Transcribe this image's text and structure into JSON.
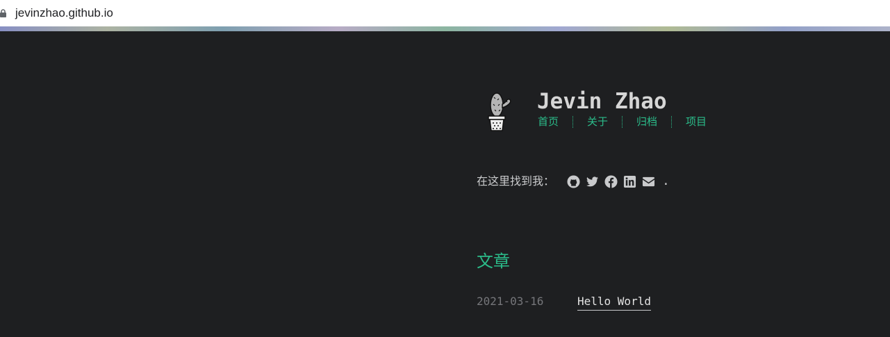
{
  "browser": {
    "url": "jevinzhao.github.io"
  },
  "header": {
    "title": "Jevin Zhao",
    "avatar_icon": "cactus-icon",
    "nav": [
      {
        "label": "首页"
      },
      {
        "label": "关于"
      },
      {
        "label": "归档"
      },
      {
        "label": "项目"
      }
    ]
  },
  "find_me": {
    "label": "在这里找到我：",
    "icons": [
      "github-icon",
      "twitter-icon",
      "facebook-icon",
      "linkedin-icon",
      "envelope-icon"
    ],
    "trailing": "."
  },
  "posts_section": {
    "title": "文章",
    "posts": [
      {
        "date": "2021-03-16",
        "title": "Hello World"
      }
    ]
  },
  "colors": {
    "background": "#1e1f21",
    "accent": "#2bbc8a",
    "text": "#c9cacc",
    "muted": "#75767a"
  }
}
